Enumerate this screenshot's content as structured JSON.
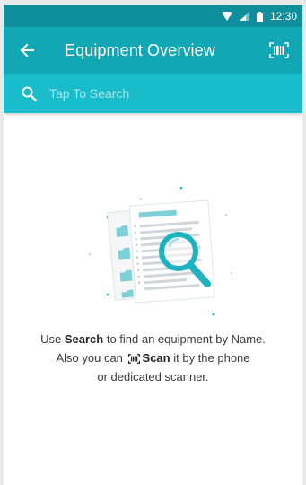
{
  "status_bar": {
    "time": "12:30"
  },
  "app_bar": {
    "title": "Equipment Overview"
  },
  "search": {
    "placeholder": "Tap To Search",
    "value": ""
  },
  "empty_state": {
    "line1_prefix": "Use ",
    "line1_bold": "Search",
    "line1_suffix": " to find an equipment by Name.",
    "line2_prefix": "Also you can ",
    "line2_bold": "Scan",
    "line2_suffix": " it by the phone",
    "line3": "or dedicated scanner."
  },
  "icons": {
    "back": "arrow-left-icon",
    "scan": "barcode-scan-icon",
    "search": "search-icon",
    "wifi": "wifi-icon",
    "signal": "signal-icon",
    "battery": "battery-icon"
  },
  "colors": {
    "status_bar": "#0e8f9b",
    "app_bar": "#12a7b4",
    "search_bar": "#19bccb",
    "accent": "#1fb3c2"
  }
}
